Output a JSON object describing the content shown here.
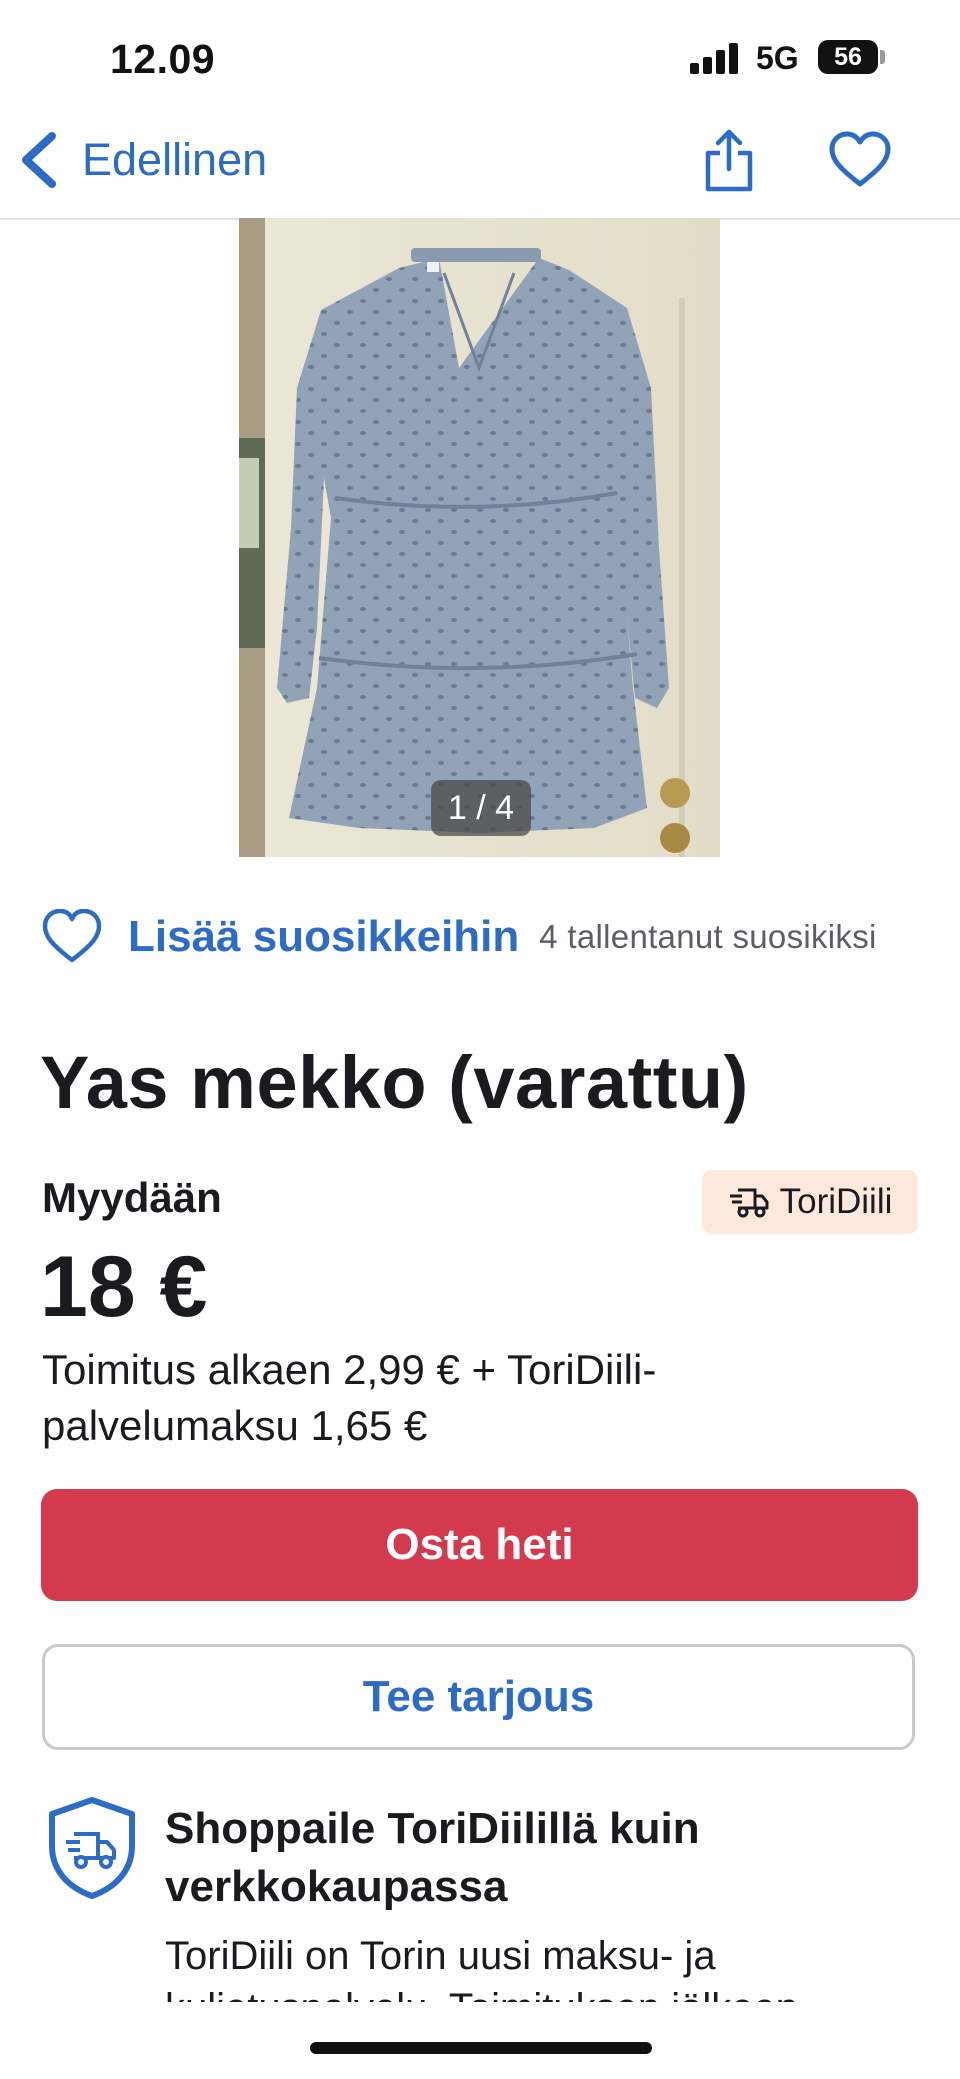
{
  "status_bar": {
    "time": "12.09",
    "network": "5G",
    "battery": "56"
  },
  "nav": {
    "back_label": "Edellinen",
    "back_icon": "chevron-left-icon",
    "share_icon": "share-icon",
    "favorite_icon": "heart-icon"
  },
  "gallery": {
    "counter": "1 / 4"
  },
  "favorite": {
    "label": "Lisää suosikkeihin",
    "count_text": "4 tallentanut suosikiksi"
  },
  "listing": {
    "title": "Yas mekko (varattu)",
    "type": "Myydään",
    "badge": "ToriDiili",
    "price": "18 €",
    "shipping": "Toimitus alkaen 2,99 € + ToriDiili-palvelumaksu 1,65 €"
  },
  "actions": {
    "buy_label": "Osta heti",
    "offer_label": "Tee tarjous"
  },
  "info": {
    "title": "Shoppaile ToriDiilillä kuin verkkokaupassa",
    "body": "ToriDiili on Torin uusi maksu- ja kuljetuspalvelu. Toimituksen jälkeen"
  },
  "colors": {
    "accent": "#2d6cc6",
    "buy": "#d43a4d",
    "badge_bg": "#fce9dc"
  }
}
